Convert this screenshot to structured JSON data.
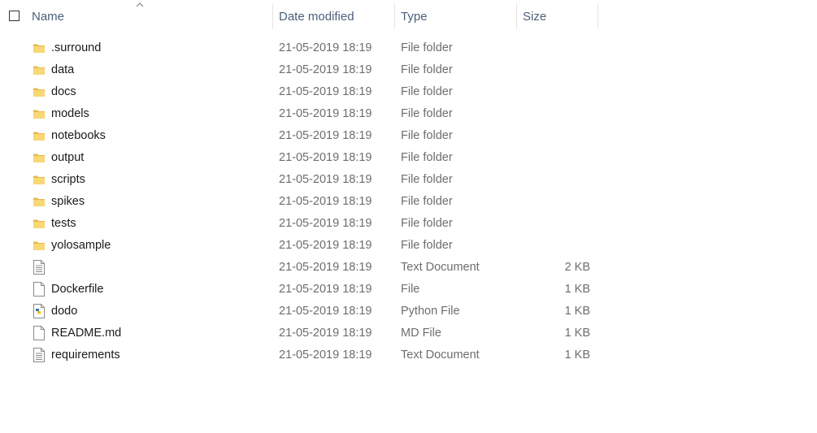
{
  "header": {
    "name_label": "Name",
    "date_label": "Date modified",
    "type_label": "Type",
    "size_label": "Size",
    "sort_indicator": "sort-ascending-icon"
  },
  "files": [
    {
      "name": ".surround",
      "date": "21-05-2019 18:19",
      "type": "File folder",
      "size": "",
      "icon": "folder-icon"
    },
    {
      "name": "data",
      "date": "21-05-2019 18:19",
      "type": "File folder",
      "size": "",
      "icon": "folder-icon"
    },
    {
      "name": "docs",
      "date": "21-05-2019 18:19",
      "type": "File folder",
      "size": "",
      "icon": "folder-icon"
    },
    {
      "name": "models",
      "date": "21-05-2019 18:19",
      "type": "File folder",
      "size": "",
      "icon": "folder-icon"
    },
    {
      "name": "notebooks",
      "date": "21-05-2019 18:19",
      "type": "File folder",
      "size": "",
      "icon": "folder-icon"
    },
    {
      "name": "output",
      "date": "21-05-2019 18:19",
      "type": "File folder",
      "size": "",
      "icon": "folder-icon"
    },
    {
      "name": "scripts",
      "date": "21-05-2019 18:19",
      "type": "File folder",
      "size": "",
      "icon": "folder-icon"
    },
    {
      "name": "spikes",
      "date": "21-05-2019 18:19",
      "type": "File folder",
      "size": "",
      "icon": "folder-icon"
    },
    {
      "name": "tests",
      "date": "21-05-2019 18:19",
      "type": "File folder",
      "size": "",
      "icon": "folder-icon"
    },
    {
      "name": "yolosample",
      "date": "21-05-2019 18:19",
      "type": "File folder",
      "size": "",
      "icon": "folder-icon"
    },
    {
      "name": "",
      "date": "21-05-2019 18:19",
      "type": "Text Document",
      "size": "2 KB",
      "icon": "text-document-icon"
    },
    {
      "name": "Dockerfile",
      "date": "21-05-2019 18:19",
      "type": "File",
      "size": "1 KB",
      "icon": "blank-file-icon"
    },
    {
      "name": "dodo",
      "date": "21-05-2019 18:19",
      "type": "Python File",
      "size": "1 KB",
      "icon": "python-file-icon"
    },
    {
      "name": "README.md",
      "date": "21-05-2019 18:19",
      "type": "MD File",
      "size": "1 KB",
      "icon": "blank-file-icon"
    },
    {
      "name": "requirements",
      "date": "21-05-2019 18:19",
      "type": "Text Document",
      "size": "1 KB",
      "icon": "text-document-icon"
    }
  ],
  "colors": {
    "header_text": "#4c607a",
    "detail_text": "#6d6d6d",
    "name_text": "#1a1a1a",
    "folder": "#f8d775",
    "folder_dark": "#e8b84a"
  }
}
